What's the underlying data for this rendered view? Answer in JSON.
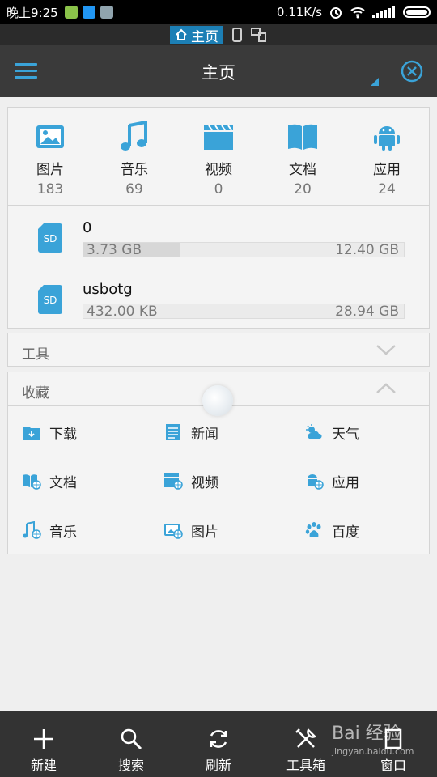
{
  "status_bar": {
    "time": "晚上9:25",
    "speed": "0.11K/s"
  },
  "location_bar": {
    "home_label": "主页"
  },
  "header": {
    "title": "主页"
  },
  "categories": [
    {
      "name": "图片",
      "count": "183",
      "icon": "image-icon"
    },
    {
      "name": "音乐",
      "count": "69",
      "icon": "music-icon"
    },
    {
      "name": "视频",
      "count": "0",
      "icon": "video-icon"
    },
    {
      "name": "文档",
      "count": "20",
      "icon": "document-icon"
    },
    {
      "name": "应用",
      "count": "24",
      "icon": "android-icon"
    }
  ],
  "storage": [
    {
      "name": "0",
      "used": "3.73 GB",
      "total": "12.40 GB",
      "fill_fraction": 0.3,
      "icon_label": "SD"
    },
    {
      "name": "usbotg",
      "used": "432.00 KB",
      "total": "28.94 GB",
      "fill_fraction": 0.0,
      "icon_label": "SD"
    }
  ],
  "sections": {
    "tools": "工具",
    "favorites": "收藏"
  },
  "favorites": [
    {
      "name": "下载",
      "icon": "download-folder-icon"
    },
    {
      "name": "新闻",
      "icon": "news-icon"
    },
    {
      "name": "天气",
      "icon": "weather-icon"
    },
    {
      "name": "文档",
      "icon": "document-web-icon"
    },
    {
      "name": "视频",
      "icon": "video-web-icon"
    },
    {
      "name": "应用",
      "icon": "app-web-icon"
    },
    {
      "name": "音乐",
      "icon": "music-web-icon"
    },
    {
      "name": "图片",
      "icon": "image-web-icon"
    },
    {
      "name": "百度",
      "icon": "baidu-icon"
    }
  ],
  "toolbar": {
    "new": "新建",
    "search": "搜索",
    "refresh": "刷新",
    "tools": "工具箱",
    "window": "窗口"
  },
  "watermark": {
    "main": "Bai 经验",
    "sub": "jingyan.baidu.com"
  },
  "colors": {
    "accent": "#3aa3d8",
    "header_bg": "#3a3a3a",
    "bottom_bg": "#333333"
  }
}
